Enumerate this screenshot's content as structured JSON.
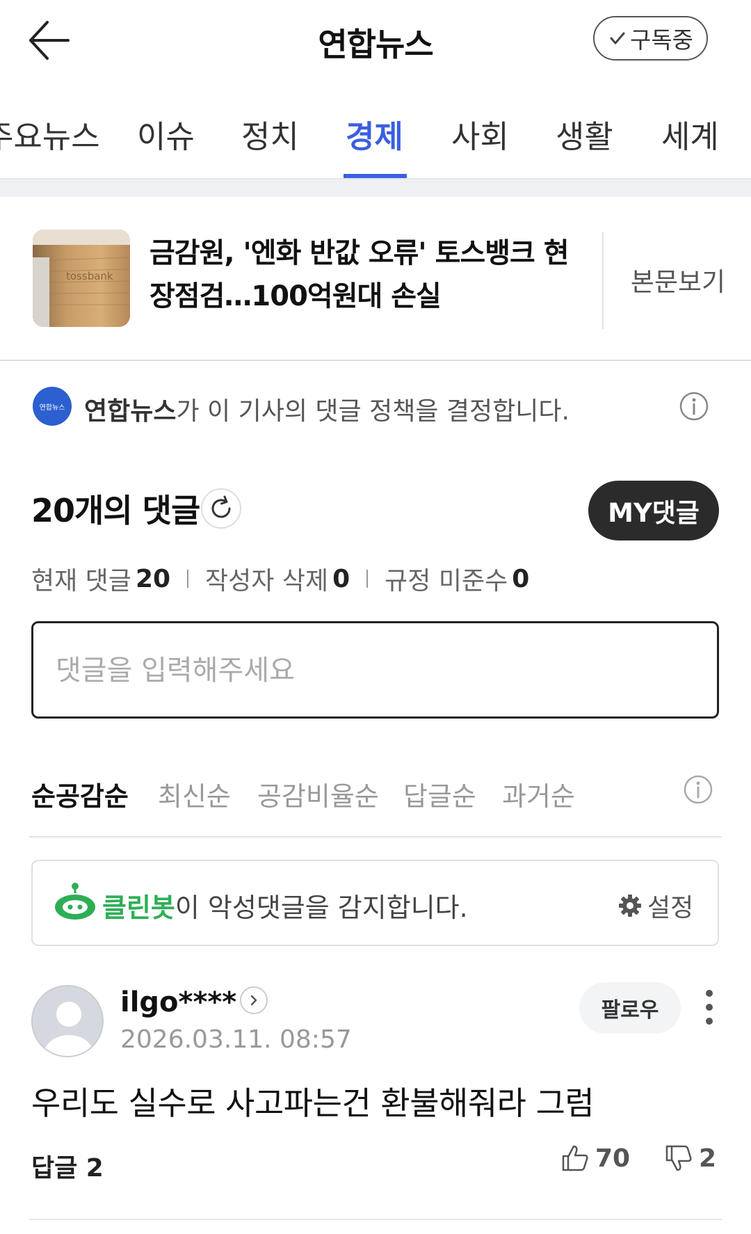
{
  "header": {
    "title": "연합뉴스",
    "subscribe_label": "구독중"
  },
  "tabs": [
    {
      "label": "주요뉴스"
    },
    {
      "label": "이슈"
    },
    {
      "label": "정치"
    },
    {
      "label": "경제",
      "active": true
    },
    {
      "label": "사회"
    },
    {
      "label": "생활"
    },
    {
      "label": "세계"
    }
  ],
  "article": {
    "title": "금감원, '엔화 반값 오류' 토스뱅크 현장점검…100억원대 손실",
    "view_body_label": "본문보기",
    "thumb_text": "tossbank"
  },
  "policy": {
    "press_logo_text": "연합뉴스",
    "press_name": "연합뉴스",
    "text_rest": "가 이 기사의 댓글 정책을 결정합니다."
  },
  "comments": {
    "count_title": "20개의 댓글",
    "my_comments_label": "MY댓글",
    "stats": {
      "current_label": "현재 댓글",
      "current_value": "20",
      "deleted_label": "작성자 삭제",
      "deleted_value": "0",
      "violation_label": "규정 미준수",
      "violation_value": "0"
    },
    "input_placeholder": "댓글을 입력해주세요"
  },
  "sort": {
    "options": [
      "순공감순",
      "최신순",
      "공감비율순",
      "답글순",
      "과거순"
    ],
    "active_index": 0
  },
  "cleanbot": {
    "name": "클린봇",
    "text_rest": "이 악성댓글을 감지합니다.",
    "settings_label": "설정"
  },
  "comment": {
    "username": "ilgo****",
    "date": "2026.03.11. 08:57",
    "follow_label": "팔로우",
    "text": "우리도 실수로 사고파는건 환불해줘라 그럼",
    "reply_label": "답글",
    "reply_count": "2",
    "like_count": "70",
    "dislike_count": "2"
  },
  "colors": {
    "accent_blue": "#3a5fe0",
    "cleanbot_green": "#2dae55",
    "dark_button": "#2b2b2b"
  },
  "icons": [
    "back-arrow-icon",
    "check-icon",
    "info-icon",
    "refresh-icon",
    "gear-icon",
    "cleanbot-icon",
    "chevron-right-icon",
    "more-vertical-icon",
    "thumbs-up-icon",
    "thumbs-down-icon"
  ]
}
